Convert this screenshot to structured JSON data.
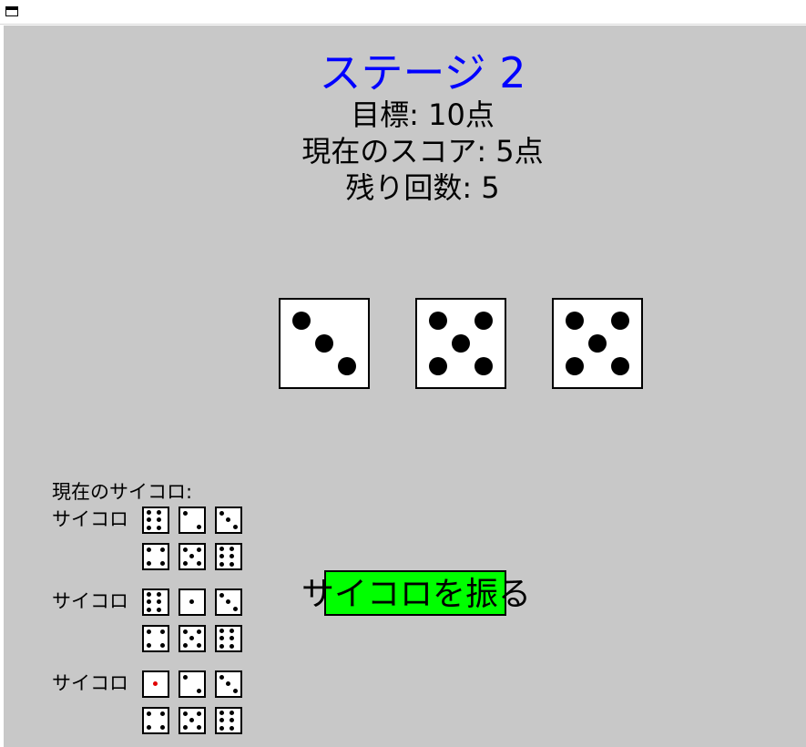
{
  "game": {
    "title": "ステージ 2",
    "target": "目標: 10点",
    "score": "現在のスコア: 5点",
    "remaining": "残り回数: 5",
    "title_color": "#0000ff",
    "rolled_dice": [
      3,
      5,
      5
    ],
    "roll_button_label": "サイコロを振る",
    "button_color": "#00ff00"
  },
  "dice_panel": {
    "heading": "現在のサイコロ:",
    "dice": [
      {
        "label": "サイコロ",
        "faces": [
          6,
          2,
          3,
          4,
          5,
          6
        ],
        "highlight": null
      },
      {
        "label": "サイコロ",
        "faces": [
          6,
          1,
          3,
          4,
          5,
          6
        ],
        "highlight": null
      },
      {
        "label": "サイコロ",
        "faces": [
          1,
          2,
          3,
          4,
          5,
          6
        ],
        "highlight": 0
      }
    ]
  }
}
